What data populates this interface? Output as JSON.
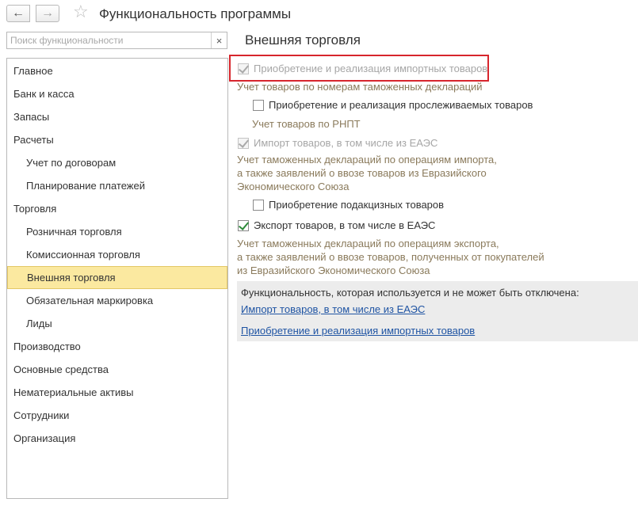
{
  "header": {
    "back_icon": "←",
    "forward_icon": "→",
    "favorite_icon": "☆",
    "title": "Функциональность программы"
  },
  "search": {
    "placeholder": "Поиск функциональности",
    "value": "",
    "clear_icon": "×"
  },
  "sidebar": {
    "items": [
      {
        "label": "Главное",
        "level": 0,
        "selected": false
      },
      {
        "label": "Банк и касса",
        "level": 0,
        "selected": false
      },
      {
        "label": "Запасы",
        "level": 0,
        "selected": false
      },
      {
        "label": "Расчеты",
        "level": 0,
        "selected": false
      },
      {
        "label": "Учет по договорам",
        "level": 1,
        "selected": false
      },
      {
        "label": "Планирование платежей",
        "level": 1,
        "selected": false
      },
      {
        "label": "Торговля",
        "level": 0,
        "selected": false
      },
      {
        "label": "Розничная торговля",
        "level": 1,
        "selected": false
      },
      {
        "label": "Комиссионная торговля",
        "level": 1,
        "selected": false
      },
      {
        "label": "Внешняя торговля",
        "level": 1,
        "selected": true
      },
      {
        "label": "Обязательная маркировка",
        "level": 1,
        "selected": false
      },
      {
        "label": "Лиды",
        "level": 1,
        "selected": false
      },
      {
        "label": "Производство",
        "level": 0,
        "selected": false
      },
      {
        "label": "Основные средства",
        "level": 0,
        "selected": false
      },
      {
        "label": "Нематериальные активы",
        "level": 0,
        "selected": false
      },
      {
        "label": "Сотрудники",
        "level": 0,
        "selected": false
      },
      {
        "label": "Организация",
        "level": 0,
        "selected": false
      }
    ]
  },
  "main": {
    "section_title": "Внешняя торговля",
    "options": [
      {
        "label": "Приобретение и реализация импортных товаров",
        "checked": true,
        "disabled": true,
        "hint": "Учет товаров по номерам таможенных деклараций"
      },
      {
        "label": "Приобретение и реализация прослеживаемых товаров",
        "checked": false,
        "disabled": false,
        "hint": "Учет товаров по РНПТ"
      },
      {
        "label": "Импорт товаров, в том числе из ЕАЭС",
        "checked": true,
        "disabled": true,
        "hint_lines": [
          "Учет таможенных деклараций по операциям импорта,",
          "а также заявлений о ввозе товаров из Евразийского",
          "Экономического Союза"
        ]
      },
      {
        "label": "Приобретение подакцизных товаров",
        "checked": false,
        "disabled": false
      },
      {
        "label": "Экспорт товаров, в том числе в ЕАЭС",
        "checked": true,
        "disabled": false,
        "hint_lines": [
          "Учет таможенных деклараций по операциям экспорта,",
          "а также заявлений о ввозе товаров, полученных от покупателей",
          "из Евразийского Экономического Союза"
        ]
      }
    ],
    "info": {
      "title": "Функциональность, которая используется и не может быть отключена:",
      "links": [
        "Импорт товаров, в том числе из ЕАЭС",
        "Приобретение и реализация импортных товаров"
      ]
    }
  },
  "colors": {
    "highlight": "#d7262d",
    "selected_bg": "#fbe9a0",
    "link": "#1f54a3",
    "hint": "#8a7a5b",
    "check": "#2e8b3a"
  }
}
